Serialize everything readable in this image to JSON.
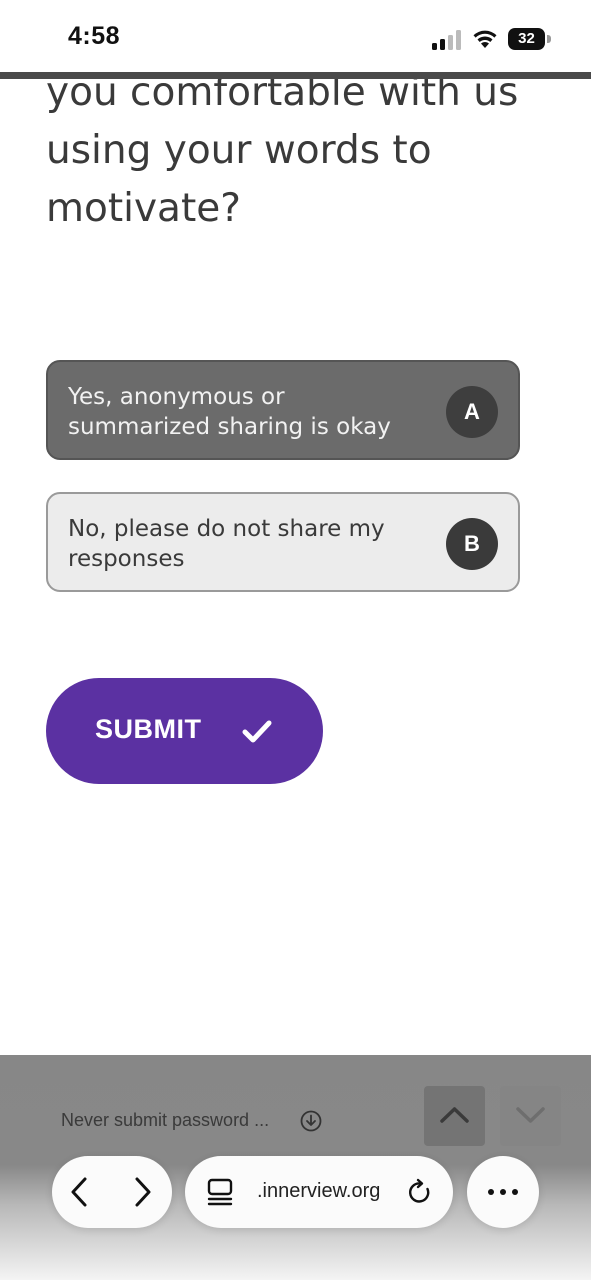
{
  "status_bar": {
    "time": "4:58",
    "battery": "32"
  },
  "question": {
    "text": "you comfortable with us using your words to motivate?"
  },
  "options": [
    {
      "label": "Yes, anonymous or summarized sharing is okay",
      "key": "A",
      "selected": true
    },
    {
      "label": "No, please do not share my responses",
      "key": "B",
      "selected": false
    }
  ],
  "submit": {
    "label": "SUBMIT"
  },
  "browser": {
    "password_hint": "Never submit password  ...",
    "url": ".innerview.org"
  },
  "colors": {
    "accent": "#5b31a2",
    "selected_option": "#6b6b6b",
    "option_bg": "#ececec"
  },
  "icons": [
    "signal-icon",
    "wifi-icon",
    "battery-icon",
    "check-icon",
    "download-icon",
    "chevron-up-icon",
    "chevron-down-icon",
    "back-icon",
    "forward-icon",
    "tabs-icon",
    "reload-icon",
    "more-icon"
  ]
}
